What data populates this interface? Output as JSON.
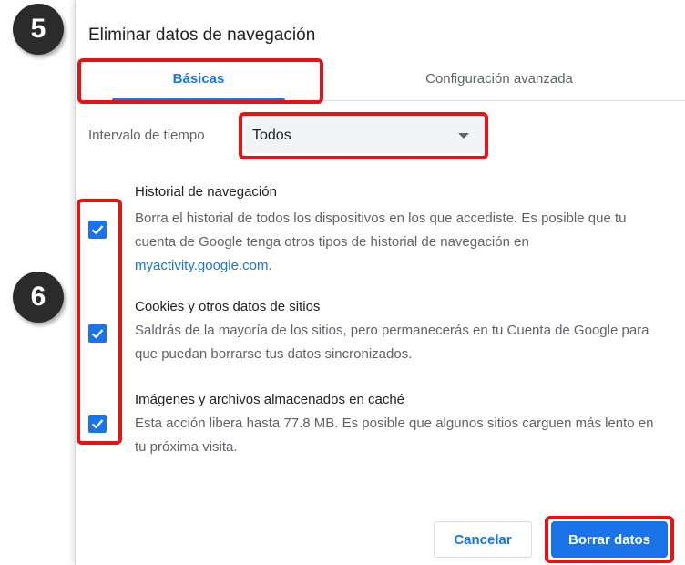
{
  "badges": {
    "step5": "5",
    "step6": "6"
  },
  "dialog": {
    "title": "Eliminar datos de navegación",
    "tabs": [
      {
        "label": "Básicas",
        "active": true
      },
      {
        "label": "Configuración avanzada",
        "active": false
      }
    ],
    "time_range": {
      "label": "Intervalo de tiempo",
      "value": "Todos"
    },
    "options": [
      {
        "title": "Historial de navegación",
        "description": "Borra el historial de todos los dispositivos en los que accediste. Es posible que tu cuenta de Google tenga otros tipos de historial de navegación en",
        "link": "myactivity.google.com",
        "link_suffix": ".",
        "checked": true
      },
      {
        "title": "Cookies y otros datos de sitios",
        "description": "Saldrás de la mayoría de los sitios, pero permanecerás en tu Cuenta de Google para que puedan borrarse tus datos sincronizados.",
        "checked": true
      },
      {
        "title": "Imágenes y archivos almacenados en caché",
        "description": "Esta acción libera hasta 77.8 MB. Es posible que algunos sitios carguen más lento en tu próxima visita.",
        "checked": true
      }
    ],
    "buttons": {
      "cancel": "Cancelar",
      "confirm": "Borrar datos"
    }
  },
  "colors": {
    "accent": "#1a73e8",
    "highlight": "#e51414",
    "badge": "#2b2b2b"
  }
}
